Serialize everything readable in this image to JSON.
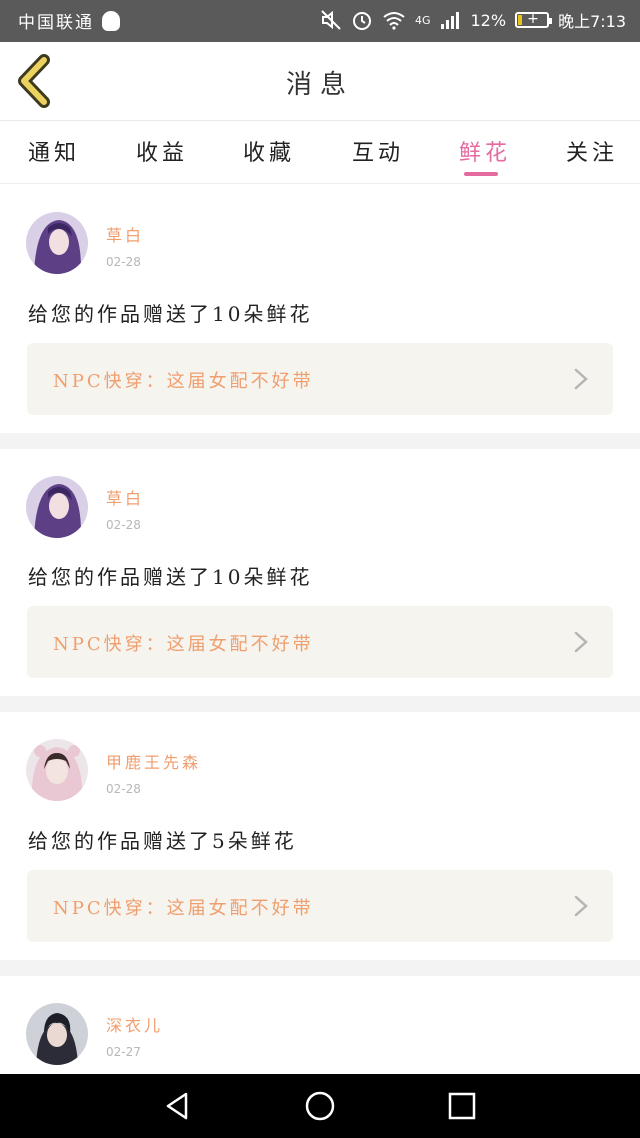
{
  "status_bar": {
    "carrier": "中国联通",
    "network": "4G",
    "battery": "12%",
    "time": "晚上7:13"
  },
  "header": {
    "title": "消息"
  },
  "tabs": [
    {
      "label": "通知",
      "active": false
    },
    {
      "label": "收益",
      "active": false
    },
    {
      "label": "收藏",
      "active": false
    },
    {
      "label": "互动",
      "active": false
    },
    {
      "label": "鲜花",
      "active": true
    },
    {
      "label": "关注",
      "active": false
    }
  ],
  "colors": {
    "accent": "#e46aa0",
    "username": "#f09e6e",
    "book_box_bg": "#f5f4ee"
  },
  "messages": [
    {
      "user": "草白",
      "date": "02-28",
      "text": "给您的作品赠送了10朵鲜花",
      "book": "NPC快穿：这届女配不好带",
      "avatar": "purple-hair-girl"
    },
    {
      "user": "草白",
      "date": "02-28",
      "text": "给您的作品赠送了10朵鲜花",
      "book": "NPC快穿：这届女配不好带",
      "avatar": "purple-hair-girl"
    },
    {
      "user": "甲鹿王先森",
      "date": "02-28",
      "text": "给您的作品赠送了5朵鲜花",
      "book": "NPC快穿：这届女配不好带",
      "avatar": "pink-hood-girl"
    },
    {
      "user": "深衣儿",
      "date": "02-27",
      "text": "",
      "book": "",
      "avatar": "dark-hair-boy"
    }
  ]
}
